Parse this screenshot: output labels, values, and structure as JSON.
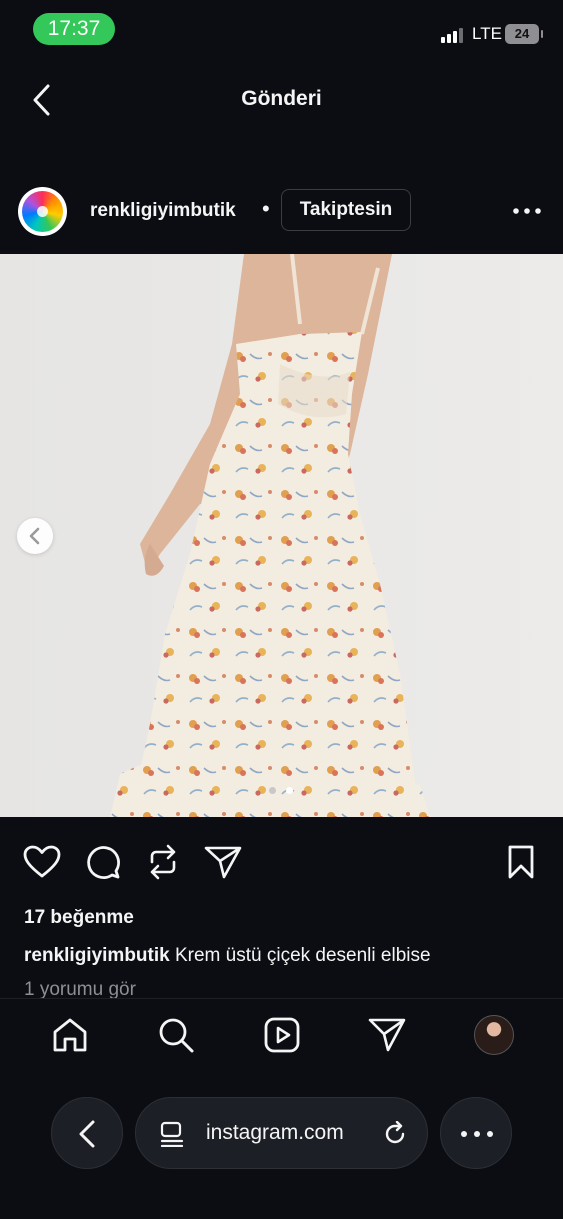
{
  "status_bar": {
    "time": "17:37",
    "network": "LTE",
    "battery": "24"
  },
  "header": {
    "title": "Gönderi"
  },
  "post": {
    "username": "renkligiyimbutik",
    "separator": "•",
    "follow_label": "Takiptesin",
    "image": {
      "description_icon": "floral-dress-photo",
      "carousel_total": 2,
      "carousel_active": 2
    },
    "likes": "17 beğenme",
    "caption_user": "renkligiyimbutik",
    "caption_text": " Krem üstü çiçek desenli elbise",
    "comments_link": "1 yorumu gör"
  },
  "bottom_nav": {
    "icons": [
      "home-icon",
      "search-icon",
      "reels-icon",
      "send-icon",
      "profile-avatar"
    ]
  },
  "browser": {
    "url": "instagram.com"
  },
  "colors": {
    "background": "#0b0d12",
    "accent_green": "#34c759",
    "muted_text": "#8e8e93"
  }
}
